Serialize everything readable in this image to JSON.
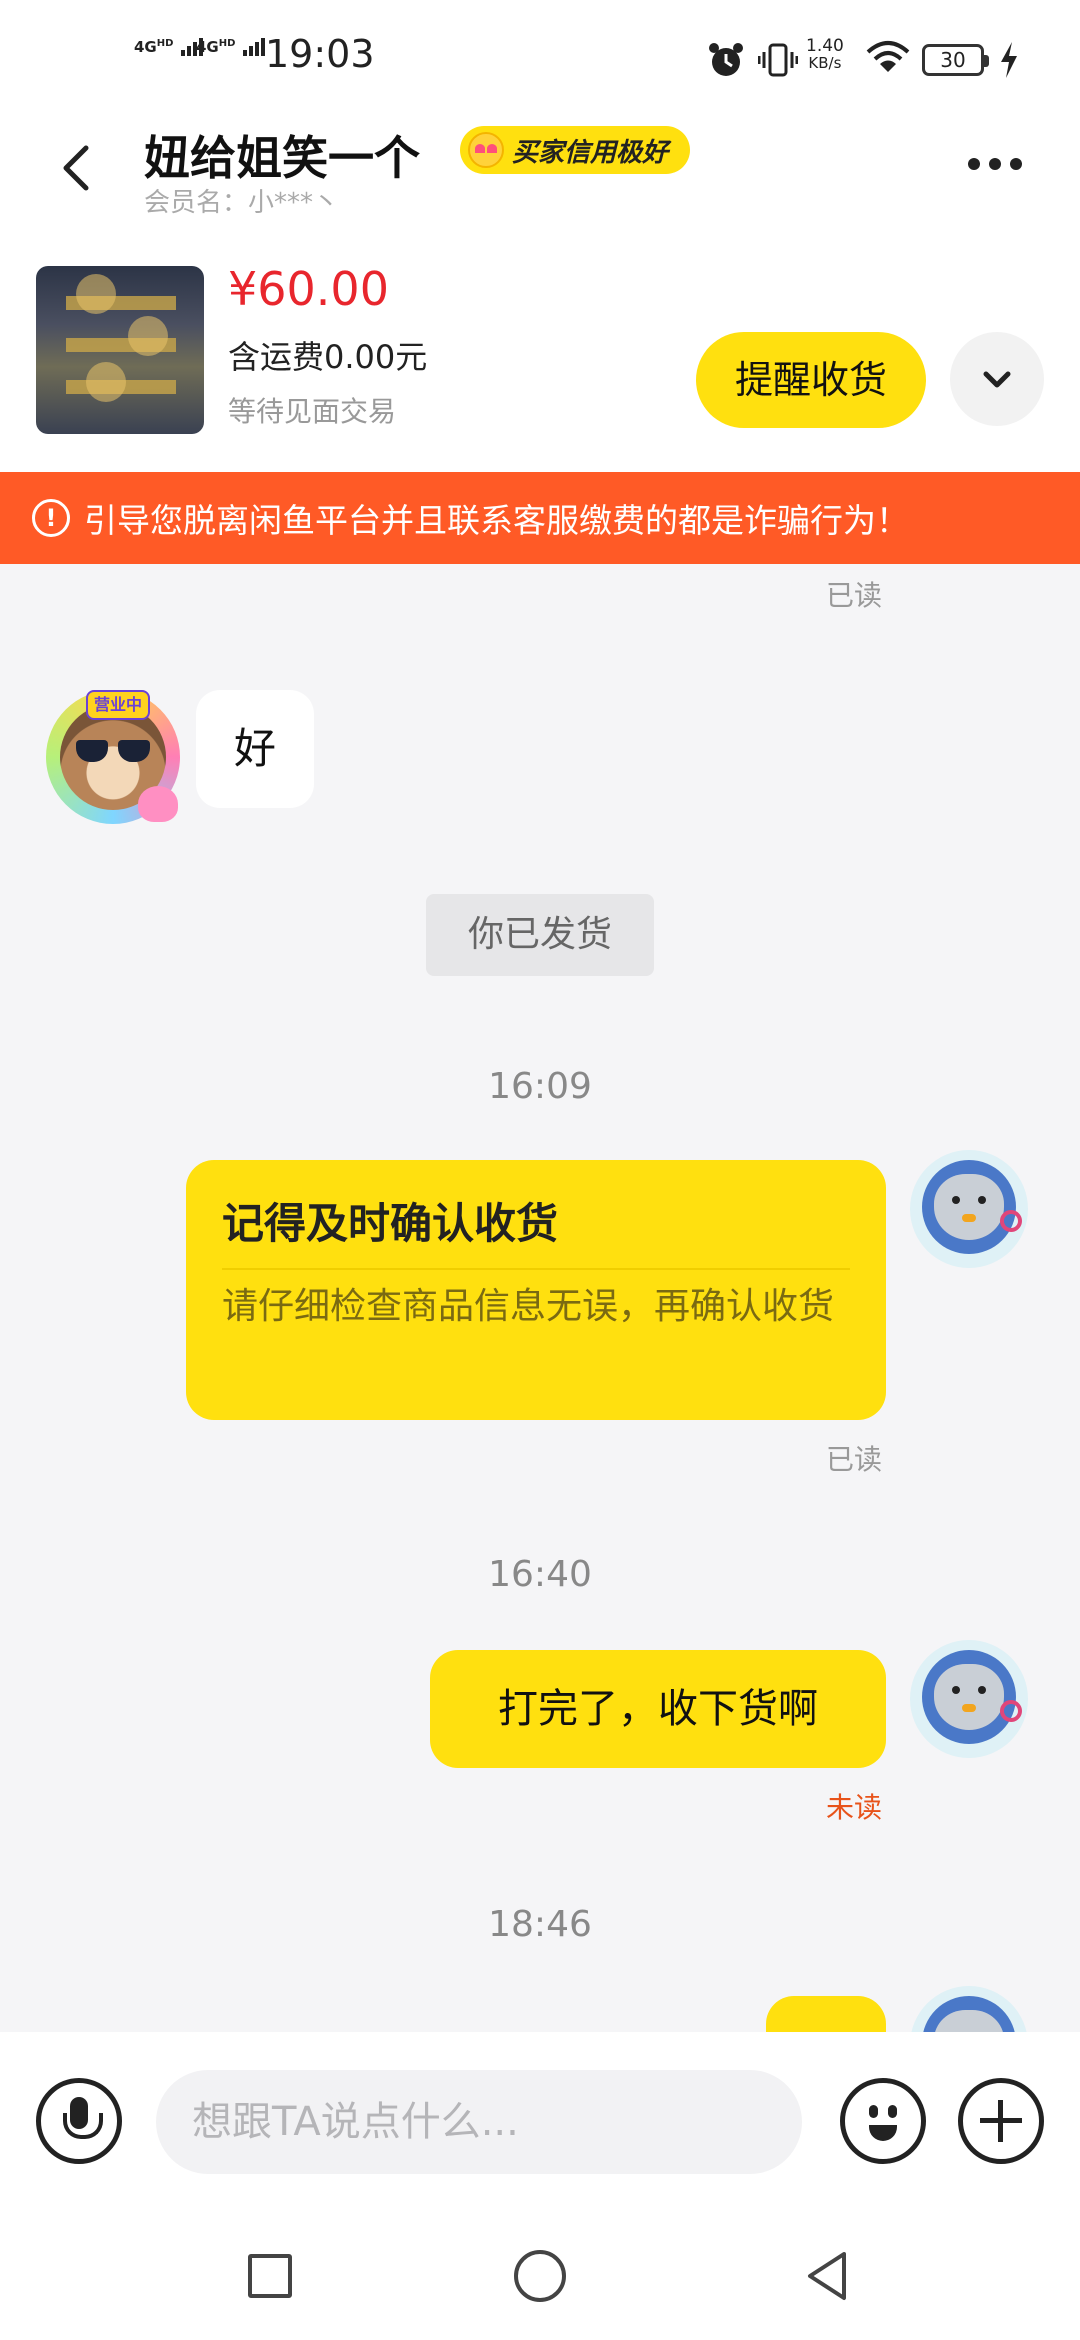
{
  "status_bar": {
    "signal_1": "4G",
    "signal_1_hd": "HD",
    "signal_2": "4G",
    "signal_2_hd": "HD",
    "time": "19:03",
    "speed_value": "1.40",
    "speed_unit": "KB/s",
    "battery": "30",
    "icons": [
      "alarm-icon",
      "vibrate-icon",
      "wifi-icon",
      "charging-icon"
    ]
  },
  "header": {
    "title": "妞给姐笑一个",
    "badge": "买家信用极好",
    "member": "会员名：小***丶"
  },
  "product": {
    "price": "¥60.00",
    "shipping": "含运费0.00元",
    "status": "等待见面交易",
    "remind_button": "提醒收货"
  },
  "warning": {
    "text": "引导您脱离闲鱼平台并且联系客服缴费的都是诈骗行为！"
  },
  "chat": {
    "read_label_top": "已读",
    "incoming_message": "好",
    "system_message": "你已发货",
    "time_1": "16:09",
    "card_title": "记得及时确认收货",
    "card_body": "请仔细检查商品信息无误，再确认收货",
    "read_label_card": "已读",
    "time_2": "16:40",
    "outgoing_message": "打完了，收下货啊",
    "unread_label": "未读",
    "time_3": "18:46",
    "left_avatar_tag": "营业中"
  },
  "input": {
    "placeholder": "想跟TA说点什么..."
  },
  "colors": {
    "accent_yellow": "#ffe00f",
    "price_red": "#e8262d",
    "warning_orange": "#ff5a26",
    "unread_orange": "#e8531a"
  }
}
